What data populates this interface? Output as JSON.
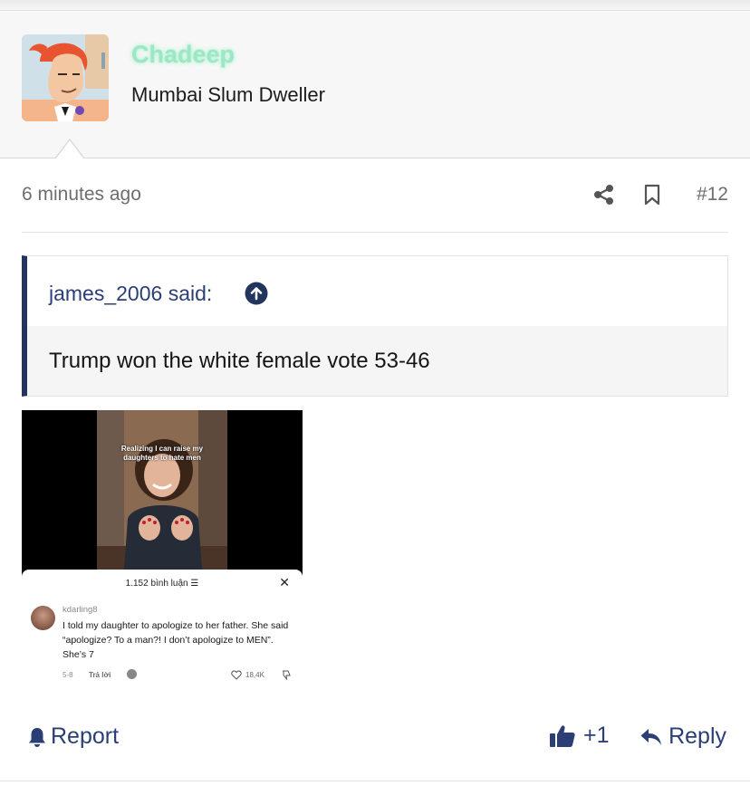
{
  "post": {
    "author": {
      "username": "Chadeep",
      "title": "Mumbai Slum Dweller",
      "username_color": "#9de7c4"
    },
    "meta": {
      "timestamp": "6 minutes ago",
      "post_number": "#12",
      "icons": [
        "share-icon",
        "bookmark-icon"
      ]
    },
    "quote": {
      "author_label": "james_2006 said:",
      "text": "Trump won the white female vote 53-46",
      "icon": "arrow-up-circle-icon"
    },
    "attachment": {
      "video_caption": "Realizing I can raise my daughters to hate men",
      "comments_title": "1.152 bình luận ☰",
      "close_label": "✕",
      "comment": {
        "username": "kdarling8",
        "text": "I told my daughter to apologize to her father. She said “apologize? To a man?! I don’t apologize to MEN”. She’s 7",
        "date": "5-8",
        "reply_label": "Trả lời",
        "likes": "18,4K"
      }
    },
    "actions": {
      "report_label": "Report",
      "like_label": "+1",
      "reply_label": "Reply"
    }
  },
  "colors": {
    "accent": "#2b3f76",
    "quote_bar": "#23355c",
    "muted_text": "#6e6e6e"
  }
}
